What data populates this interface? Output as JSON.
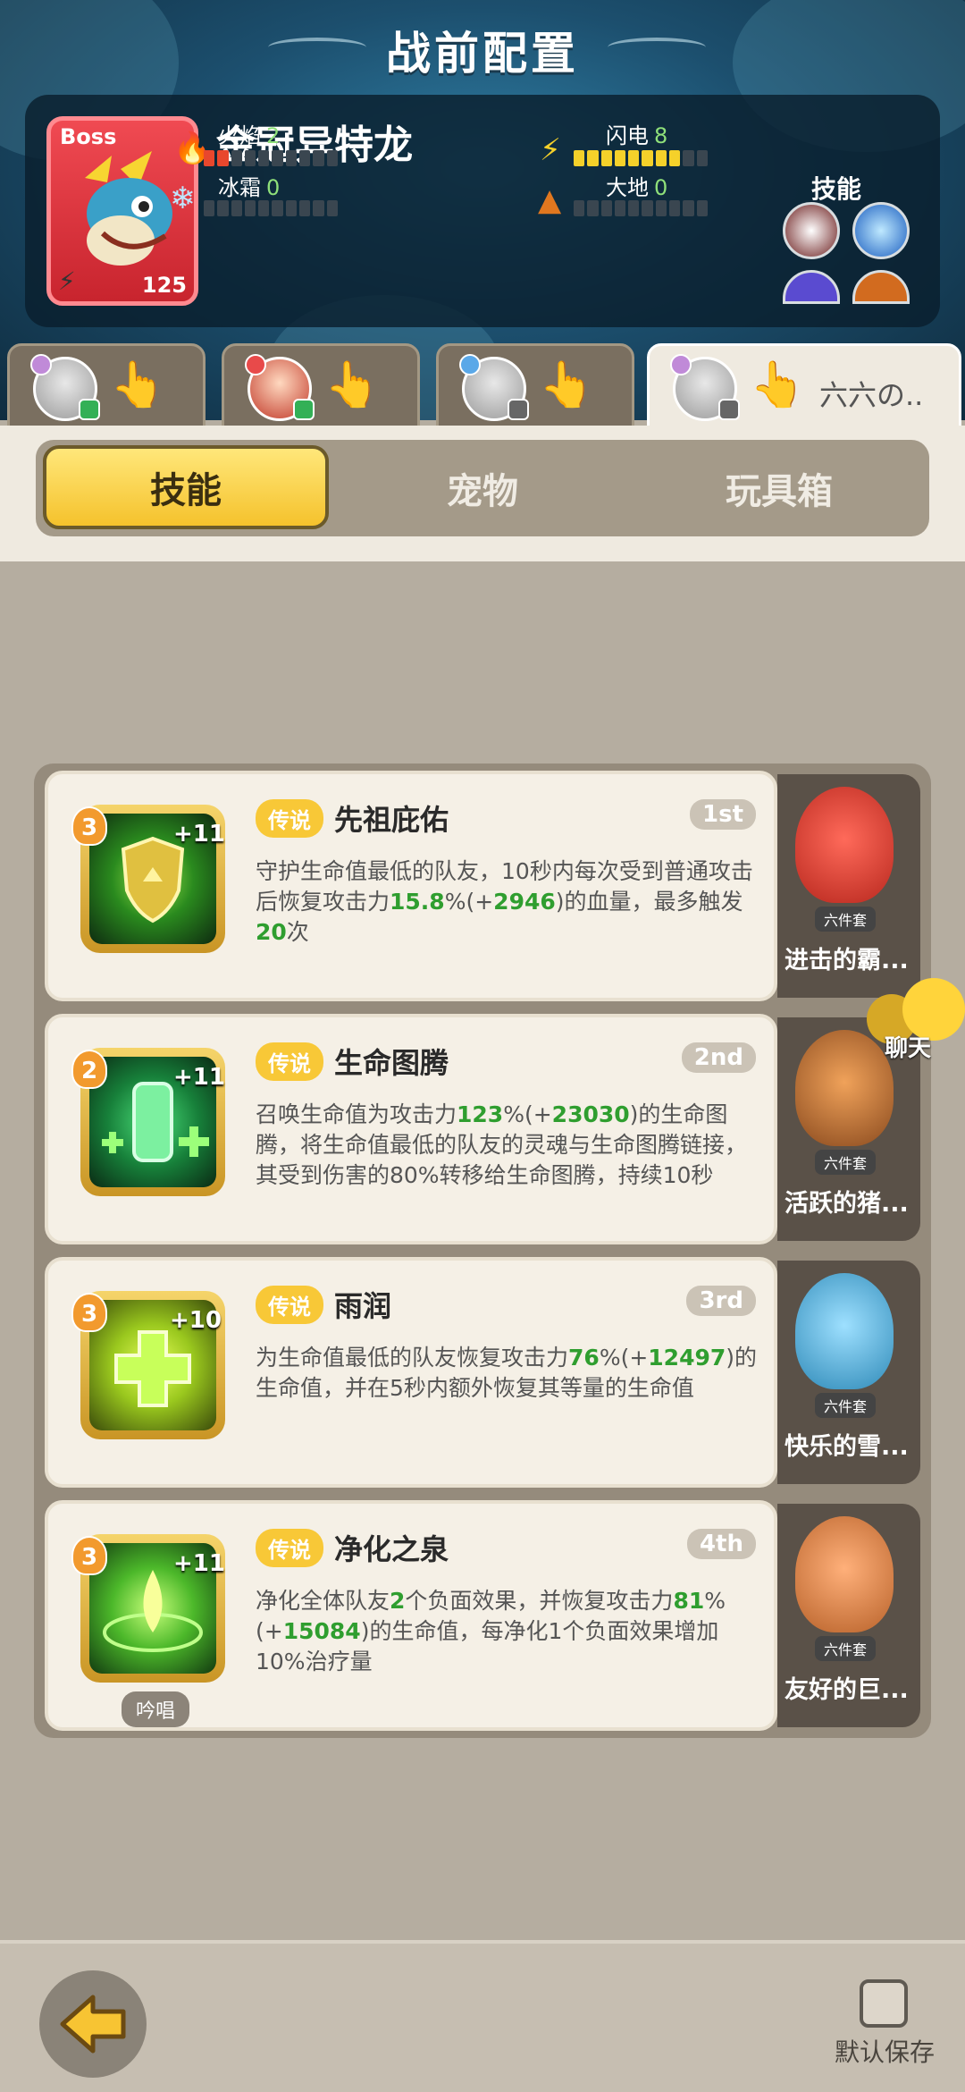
{
  "header": {
    "title": "战前配置"
  },
  "boss": {
    "tag": "Boss",
    "name": "金冠异特龙",
    "level": "125",
    "stats": {
      "fire_label": "火焰",
      "fire_value": "2",
      "lightning_label": "闪电",
      "lightning_value": "8",
      "ice_label": "冰霜",
      "ice_value": "0",
      "earth_label": "大地",
      "earth_value": "0"
    },
    "fire_level": 0.2,
    "lightning_level": 0.8,
    "skills_label": "技能"
  },
  "hero_tabs": [
    {
      "name": ""
    },
    {
      "name": ""
    },
    {
      "name": ""
    },
    {
      "name": "六六の.."
    }
  ],
  "segments": {
    "skills": "技能",
    "pets": "宠物",
    "toybox": "玩具箱"
  },
  "skills": [
    {
      "rank": "3",
      "plus": "+11",
      "rarity": "传说",
      "name": "先祖庇佑",
      "order": "1st",
      "desc": [
        "守护生命值最低的队友，10秒内每次受到普通攻击后恢复攻击力",
        "15.8",
        "%(+",
        "2946",
        ")的血量，最多触发",
        "20",
        "次"
      ],
      "pet_set": "六件套",
      "pet_name": "进击的霸..."
    },
    {
      "rank": "2",
      "plus": "+11",
      "rarity": "传说",
      "name": "生命图腾",
      "order": "2nd",
      "desc": [
        "召唤生命值为攻击力",
        "123",
        "%(+",
        "23030",
        ")的生命图腾，将生命值最低的队友的灵魂与生命图腾链接，其受到伤害的80%转移给生命图腾，持续10秒"
      ],
      "pet_set": "六件套",
      "pet_name": "活跃的猪..."
    },
    {
      "rank": "3",
      "plus": "+10",
      "rarity": "传说",
      "name": "雨润",
      "order": "3rd",
      "desc": [
        "为生命值最低的队友恢复攻击力",
        "76",
        "%(+",
        "12497",
        ")的生命值，并在5秒内额外恢复其等量的生命值"
      ],
      "pet_set": "六件套",
      "pet_name": "快乐的雪..."
    },
    {
      "rank": "3",
      "plus": "+11",
      "rarity": "传说",
      "name": "净化之泉",
      "order": "4th",
      "desc": [
        "净化全体队友",
        "2",
        "个负面效果，并恢复攻击力",
        "81",
        "%(+",
        "15084",
        ")的生命值，每净化1个负面效果增加10%治疗量"
      ],
      "chant": "吟唱",
      "pet_set": "六件套",
      "pet_name": "友好的巨..."
    }
  ],
  "chat": {
    "label": "聊天"
  },
  "footer": {
    "save_label": "默认保存"
  }
}
